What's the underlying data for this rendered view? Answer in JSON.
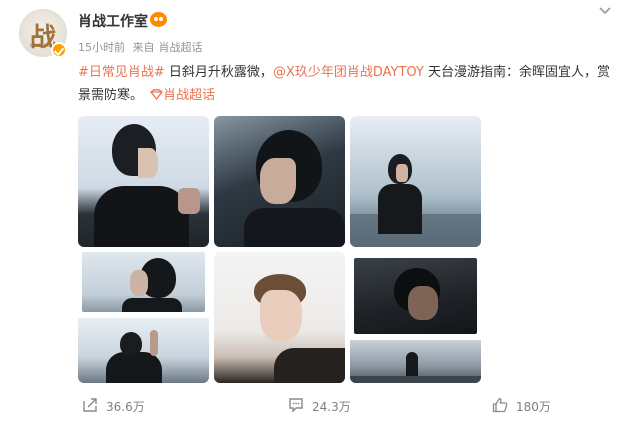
{
  "post": {
    "author": "肖战工作室",
    "time": "15小时前",
    "source_prefix": "来自",
    "source": "肖战超话",
    "avatar_text": "战",
    "avatar_sub": "XZ STUDIO",
    "hashtag": "#日常见肖战#",
    "text_part1": " 日斜月升秋露微，",
    "mention": "@X玖少年团肖战DAYTOY",
    "text_part2": " 天台漫游指南：余晖固宜人，赏景需防寒。",
    "supertopic": "肖战超话"
  },
  "actions": {
    "forward_count": "36.6万",
    "comment_count": "24.3万",
    "like_count": "180万"
  },
  "colors": {
    "link": "#eb7350",
    "verified": "#ffa000",
    "badge": "#ff8a00"
  },
  "icons": [
    "verified-icon",
    "vip-badge-icon",
    "chevron-down-icon",
    "supertopic-icon",
    "forward-icon",
    "comment-icon",
    "like-icon"
  ]
}
